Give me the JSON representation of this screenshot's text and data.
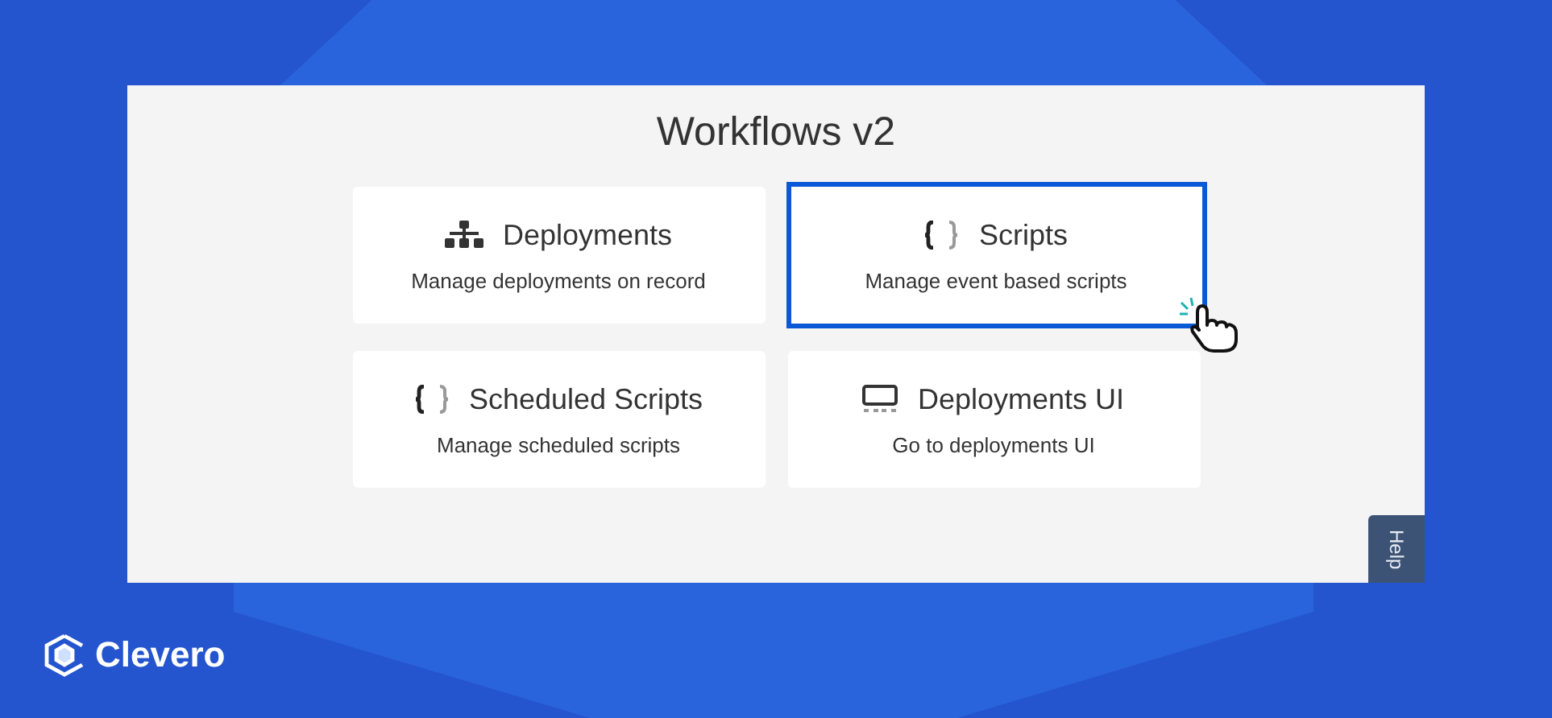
{
  "panel": {
    "title": "Workflows v2",
    "cards": [
      {
        "kind": "hierarchy",
        "title": "Deployments",
        "description": "Manage deployments on record",
        "selected": false
      },
      {
        "kind": "code",
        "title": "Scripts",
        "description": "Manage event based scripts",
        "selected": true
      },
      {
        "kind": "code",
        "title": "Scheduled Scripts",
        "description": "Manage scheduled scripts",
        "selected": false
      },
      {
        "kind": "display",
        "title": "Deployments UI",
        "description": "Go to deployments UI",
        "selected": false
      }
    ],
    "help_tab": "Help"
  },
  "logo": {
    "text": "Clevero"
  }
}
